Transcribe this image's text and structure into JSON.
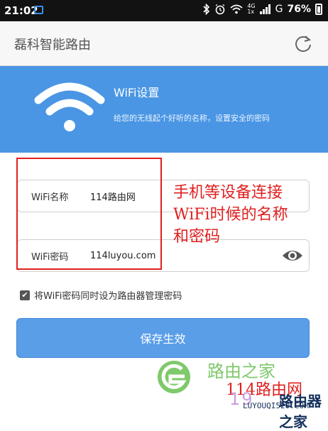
{
  "status_bar": {
    "time": "21:02",
    "network_small_top": "4G",
    "network_small_bottom": "1x",
    "carrier": "G",
    "battery": "76%"
  },
  "app_bar": {
    "title": "磊科智能路由",
    "refresh_icon": "refresh-icon"
  },
  "banner": {
    "title": "WiFi设置",
    "subtitle": "给您的无线起个好听的名称，设置安全的密码",
    "icon": "wifi-icon"
  },
  "form": {
    "wifi_name_label": "WiFi名称",
    "wifi_name_value": "114路由网",
    "wifi_password_label": "WiFi密码",
    "wifi_password_value": "114luyou.com",
    "show_password_icon": "eye-icon",
    "sync_checkbox_checked": true,
    "sync_checkbox_label": "将WiFi密码同时设为路由器管理密码",
    "save_label": "保存生效"
  },
  "annotation": {
    "text": "手机等设备连接\nWiFi时候的名称\n和密码"
  },
  "watermark": {
    "line1": "路由之家",
    "line2": "114路由网",
    "line3": "19",
    "line4": "路由器之家",
    "line5": "LUYOUQI520.COM"
  },
  "colors": {
    "banner": "#4a96e4",
    "button": "#5a9ee8",
    "annotation": "#e02020"
  }
}
